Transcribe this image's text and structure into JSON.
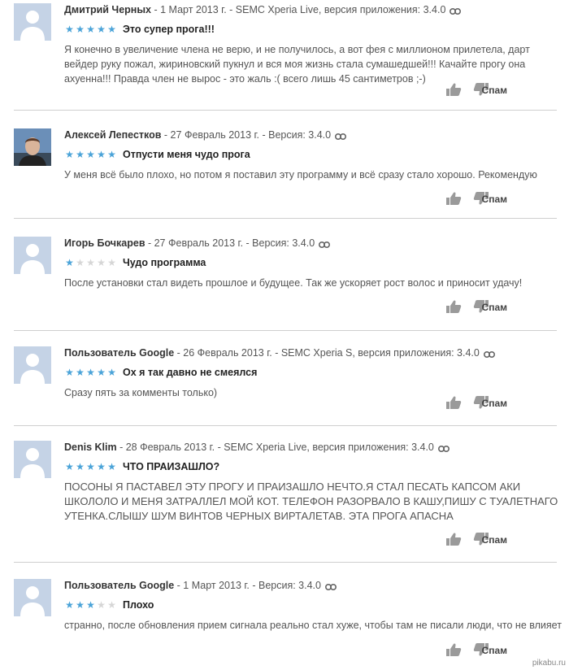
{
  "reviews": [
    {
      "author": "Дмитрий Черных",
      "meta": " - 1 Март 2013 г. - SEMC Xperia Live, версия приложения: 3.4.0",
      "rating": 5,
      "title": "Это супер прога!!!",
      "body": "Я конечно в увеличение члена не верю, и не получилось, а вот фея с миллионом прилетела, дарт вейдер руку пожал, жириновский пукнул и вся моя жизнь стала сумашедшей!!! Качайте прогу она ахуенна!!! Правда член не вырос - это жаль :( всего лишь 45 сантиметров ;-)",
      "avatar": "default-avatar",
      "spam": "Спам"
    },
    {
      "author": "Алексей Лепестков",
      "meta": " - 27 Февраль 2013 г. - Версия: 3.4.0",
      "rating": 5,
      "title": "Отпусти меня чудо прога",
      "body": "У меня всё было плохо, но потом я поставил эту программу и всё сразу стало хорошо. Рекомендую",
      "avatar": "photo-avatar",
      "spam": "Спам"
    },
    {
      "author": "Игорь Бочкарев",
      "meta": " - 27 Февраль 2013 г. - Версия: 3.4.0",
      "rating": 1,
      "title": "Чудо программа",
      "body": "После установки стал видеть прошлое и будущее. Так же ускоряет рост волос и приносит удачу!",
      "avatar": "default-avatar",
      "spam": "Спам"
    },
    {
      "author": "Пользователь Google",
      "meta": " - 26 Февраль 2013 г. - SEMC Xperia S, версия приложения: 3.4.0",
      "rating": 5,
      "title": "Ох я так давно не смеялся",
      "body": "Сразу пять за комменты только)",
      "avatar": "default-avatar",
      "spam": "Спам"
    },
    {
      "author": "Denis Klim",
      "meta": " - 28 Февраль 2013 г. - SEMC Xperia Live, версия приложения: 3.4.0",
      "rating": 5,
      "title": "ЧТО ПРАИЗАШЛО?",
      "body": "ПОСОНЫ Я ПАСТАВЕЛ ЭТУ ПРОГУ И ПРАИЗАШЛО НЕЧТО.Я СТАЛ ПЕСАТЬ КАПСОМ АКИ ШКОЛОЛО И МЕНЯ ЗАТРАЛЛЕЛ МОЙ КОТ. ТЕЛЕФОН РАЗОРВАЛО В КАШУ,ПИШУ С ТУАЛЕТНАГО УТЕНКА.СЛЫШУ ШУМ ВИНТОВ ЧЕРНЫХ ВИРТАЛЕТАВ. ЭТА ПРОГА АПАСНА",
      "avatar": "default-avatar",
      "spam": "Спам"
    },
    {
      "author": "Пользователь Google",
      "meta": " - 1 Март 2013 г. - Версия: 3.4.0",
      "rating": 3,
      "title": "Плохо",
      "body": "странно, после обновления прием сигнала реально стал хуже, чтобы там не писали люди, что не влияет",
      "avatar": "default-avatar",
      "spam": "Спам"
    }
  ],
  "watermark": "pikabu.ru",
  "colors": {
    "star_on": "#4aa3d8",
    "star_off": "#d6d6d6",
    "avatar_bg": "#c5d3e6"
  }
}
